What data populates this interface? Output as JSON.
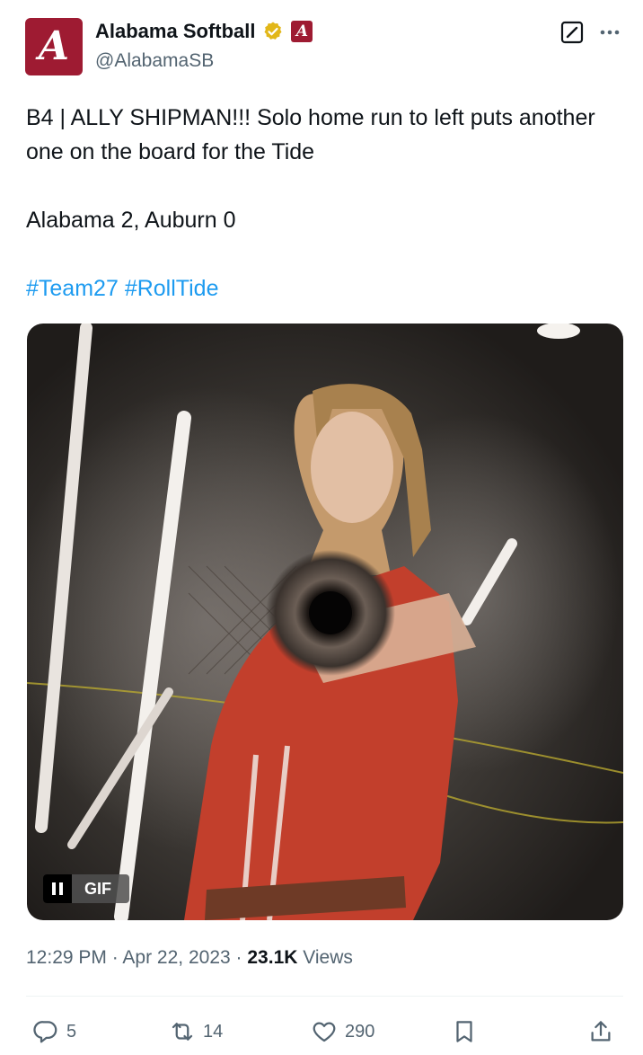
{
  "author": {
    "avatar_letter": "A",
    "display_name": "Alabama Softball",
    "handle": "@AlabamaSB",
    "verified_icon": "verified-gold-badge-icon",
    "affiliate_badge_letter": "A",
    "brand_color": "#9e1b32"
  },
  "tweet": {
    "line1": "B4 | ALLY SHIPMAN!!! Solo home run to left puts another one on the board for the Tide",
    "line2": "Alabama 2, Auburn 0",
    "hashtag1": "#Team27",
    "hashtag2": "#RollTide",
    "hashtag_color": "#1d9bf0"
  },
  "media": {
    "type_label": "GIF"
  },
  "meta": {
    "time": "12:29 PM",
    "separator": "·",
    "date": "Apr 22, 2023",
    "views_count": "23.1K",
    "views_label": "Views"
  },
  "actions": {
    "replies": "5",
    "reposts": "14",
    "likes": "290"
  }
}
